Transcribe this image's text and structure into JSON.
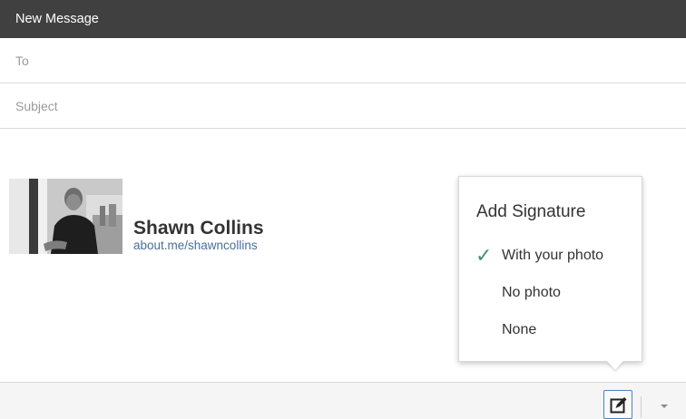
{
  "window": {
    "title": "New Message"
  },
  "fields": {
    "to_placeholder": "To",
    "subject_placeholder": "Subject"
  },
  "signature": {
    "name": "Shawn Collins",
    "link": "about.me/shawncollins",
    "photo_icon": "person-photo"
  },
  "popup": {
    "title": "Add Signature",
    "options": [
      {
        "label": "With your photo",
        "selected": true
      },
      {
        "label": "No photo",
        "selected": false
      },
      {
        "label": "None",
        "selected": false
      }
    ],
    "check_glyph": "✓"
  },
  "toolbar": {
    "signature_icon": "edit-signature-icon",
    "more_icon": "chevron-down-icon"
  },
  "colors": {
    "header_bg": "#404040",
    "link": "#4a6e9b",
    "check": "#4e8a7e",
    "button_border": "#4a82c4"
  }
}
